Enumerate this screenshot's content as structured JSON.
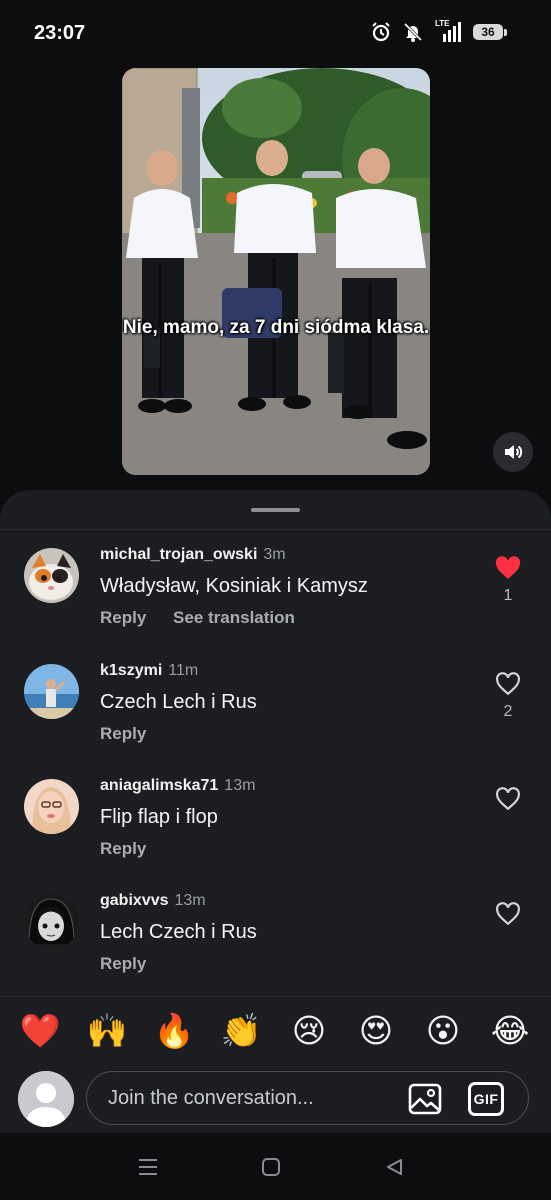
{
  "status_bar": {
    "time": "23:07",
    "network_label": "LTE",
    "battery": "36",
    "icons": [
      "alarm-icon",
      "mute-bell-icon",
      "signal-icon",
      "battery-icon"
    ]
  },
  "post": {
    "caption": "Nie, mamo, za 7 dni siódma klasa.",
    "sound_icon": "speaker-icon"
  },
  "comments": [
    {
      "username": "michal_trojan_owski",
      "time": "3m",
      "text": "Władysław, Kosiniak i Kamysz",
      "reply_label": "Reply",
      "translate_label": "See translation",
      "likes": "1",
      "liked": true
    },
    {
      "username": "k1szymi",
      "time": "11m",
      "text": "Czech Lech i Rus",
      "reply_label": "Reply",
      "translate_label": "",
      "likes": "2",
      "liked": false
    },
    {
      "username": "aniagalimska71",
      "time": "13m",
      "text": "Flip flap i flop",
      "reply_label": "Reply",
      "translate_label": "",
      "likes": "",
      "liked": false
    },
    {
      "username": "gabixvvs",
      "time": "13m",
      "text": "Lech Czech i Rus",
      "reply_label": "Reply",
      "translate_label": "",
      "likes": "",
      "liked": false
    }
  ],
  "reactions": [
    "❤️",
    "🙌",
    "🔥",
    "👏",
    "😢",
    "😍",
    "😮",
    "😂"
  ],
  "composer": {
    "placeholder": "Join the conversation...",
    "gif_label": "GIF"
  },
  "colors": {
    "background": "#0c0d0f",
    "sheet": "#1b1d21",
    "like_red": "#ff3040",
    "muted_text": "#9a9ca1"
  }
}
